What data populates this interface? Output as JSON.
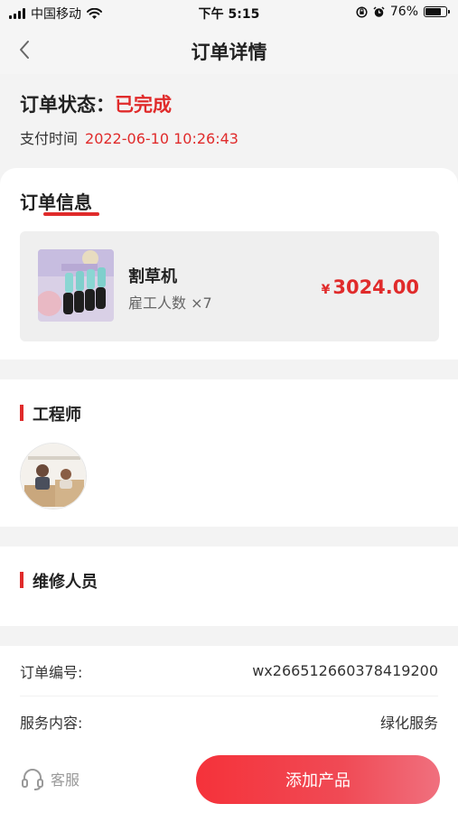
{
  "status_bar": {
    "carrier": "中国移动",
    "time": "下午 5:15",
    "battery": "76%",
    "battery_level": 0.76,
    "icons": [
      "signal-icon",
      "wifi-icon",
      "rotation-lock-icon",
      "alarm-icon",
      "battery-icon"
    ]
  },
  "nav": {
    "title": "订单详情",
    "back_icon": "chevron-left-icon"
  },
  "order_status": {
    "label": "订单状态：",
    "value": "已完成",
    "pay_time_label": "支付时间",
    "pay_time_value": "2022-06-10 10:26:43"
  },
  "order_info": {
    "heading": "订单信息",
    "product": {
      "name": "割草机",
      "count_label": "雇工人数",
      "count_value": "×7",
      "currency": "¥",
      "price": "3024.00"
    }
  },
  "engineer": {
    "heading": "工程师"
  },
  "repair_staff": {
    "heading": "维修人员"
  },
  "details": [
    {
      "label": "订单编号:",
      "value": "wx266512660378419200"
    },
    {
      "label": "服务内容:",
      "value": "绿化服务"
    }
  ],
  "bottom": {
    "service_label": "客服",
    "add_product_label": "添加产品"
  },
  "colors": {
    "accent": "#e02b2b",
    "button_gradient_start": "#f5323a",
    "button_gradient_end": "#f0707e",
    "page_bg": "#f3f3f3"
  }
}
